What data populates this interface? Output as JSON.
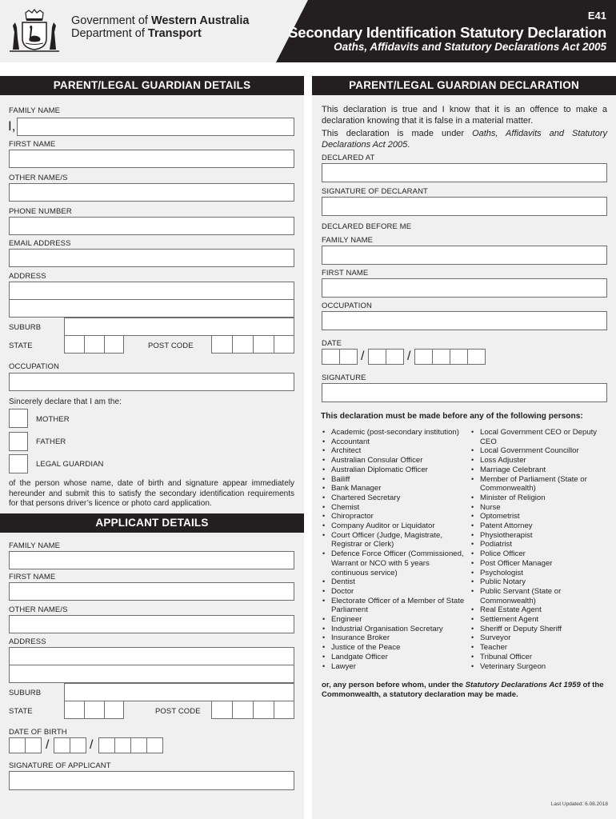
{
  "header": {
    "org_line1_prefix": "Government of ",
    "org_line1_bold": "Western Australia",
    "org_line2_prefix": "Department of ",
    "org_line2_bold": "Transport",
    "form_code": "E41",
    "title": "Secondary Identification Statutory Declaration",
    "subtitle": "Oaths, Affidavits and Statutory Declarations Act 2005",
    "crest_icon": "wa-coat-of-arms-icon"
  },
  "guardian_details": {
    "heading": "PARENT/LEGAL GUARDIAN DETAILS",
    "i_prefix": "I,",
    "family_name_label": "FAMILY NAME",
    "family_name_value": "",
    "first_name_label": "FIRST NAME",
    "first_name_value": "",
    "other_names_label": "OTHER NAME/S",
    "other_names_value": "",
    "phone_label": "PHONE NUMBER",
    "phone_value": "",
    "email_label": "EMAIL ADDRESS",
    "email_value": "",
    "address_label": "ADDRESS",
    "address_line1": "",
    "address_line2": "",
    "suburb_label": "SUBURB",
    "suburb_value": "",
    "state_label": "STATE",
    "postcode_label": "POST CODE",
    "occupation_label": "OCCUPATION",
    "occupation_value": "",
    "declare_text": "Sincerely declare that I am the:",
    "relationship_options": [
      "MOTHER",
      "FATHER",
      "LEGAL GUARDIAN"
    ],
    "statement": "of the person whose name, date of birth and signature appear immediately hereunder and submit this to satisfy the secondary identification requirements for that persons driver’s licence or photo card application."
  },
  "applicant_details": {
    "heading": "APPLICANT DETAILS",
    "family_name_label": "FAMILY NAME",
    "first_name_label": "FIRST NAME",
    "other_names_label": "OTHER NAME/S",
    "address_label": "ADDRESS",
    "suburb_label": "SUBURB",
    "state_label": "STATE",
    "postcode_label": "POST CODE",
    "dob_label": "DATE OF BIRTH",
    "date_separator": "/",
    "signature_label": "SIGNATURE OF APPLICANT"
  },
  "guardian_declaration": {
    "heading": "PARENT/LEGAL GUARDIAN DECLARATION",
    "text1": "This declaration is true and I know that it is an offence to make a declaration knowing that it is false in a material matter.",
    "text2_prefix": "This declaration is made under ",
    "text2_italic": "Oaths, Affidavits and Statutory Declarations Act 2005",
    "text2_suffix": ".",
    "declared_at_label": "DECLARED AT",
    "signature_declarant_label": "SIGNATURE OF DECLARANT",
    "declared_before_label": "DECLARED BEFORE ME",
    "family_name_label": "FAMILY NAME",
    "first_name_label": "FIRST NAME",
    "occupation_label": "OCCUPATION",
    "date_label": "DATE",
    "date_separator": "/",
    "signature_label": "SIGNATURE",
    "persons_heading": "This declaration must be made before any of the following persons:",
    "persons_col1": [
      "Academic (post-secondary institution)",
      "Accountant",
      "Architect",
      "Australian Consular Officer",
      "Australian Diplomatic Officer",
      "Bailiff",
      "Bank Manager",
      "Chartered Secretary",
      "Chemist",
      "Chiropractor",
      "Company Auditor or Liquidator",
      "Court Officer (Judge, Magistrate, Registrar or Clerk)",
      "Defence Force Officer (Commissioned, Warrant or NCO with 5 years continuous service)",
      "Dentist",
      "Doctor",
      "Electorate Officer of a Member of State Parliament",
      "Engineer",
      "Industrial Organisation Secretary",
      "Insurance Broker",
      "Justice of the Peace",
      "Landgate Officer",
      "Lawyer"
    ],
    "persons_col2": [
      "Local Government CEO or Deputy CEO",
      "Local Government Councillor",
      "Loss Adjuster",
      "Marriage Celebrant",
      "Member of Parliament (State or Commonwealth)",
      "Minister of Religion",
      "Nurse",
      "Optometrist",
      "Patent Attorney",
      "Physiotherapist",
      "Podiatrist",
      "Police Officer",
      "Post Officer Manager",
      "Psychologist",
      "Public Notary",
      "Public Servant (State or Commonwealth)",
      "Real Estate Agent",
      "Settlement Agent",
      "Sheriff or Deputy Sheriff",
      "Surveyor",
      "Teacher",
      "Tribunal Officer",
      "Veterinary Surgeon"
    ],
    "closing_prefix": "or, any person before whom, under the ",
    "closing_italic": "Statutory Declarations Act 1959",
    "closing_suffix": " of the Commonwealth, a statutory declaration may be made."
  },
  "footer": {
    "last_updated": "Last Updated: 6.08.2018"
  }
}
